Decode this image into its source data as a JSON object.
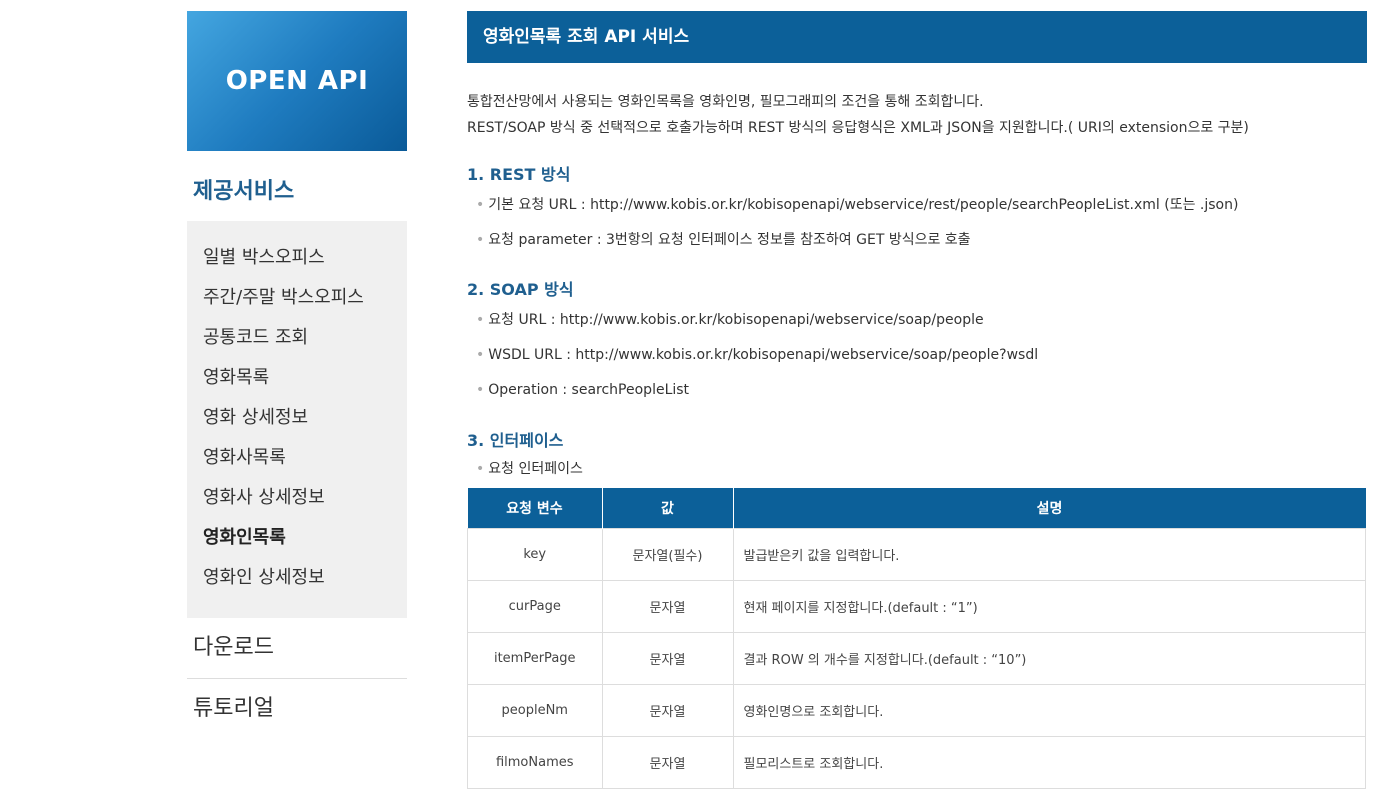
{
  "sidebar": {
    "logo_text": "OPEN API",
    "section_title": "제공서비스",
    "submenu": [
      {
        "label": "일별 박스오피스",
        "active": false
      },
      {
        "label": "주간/주말 박스오피스",
        "active": false
      },
      {
        "label": "공통코드 조회",
        "active": false
      },
      {
        "label": "영화목록",
        "active": false
      },
      {
        "label": "영화 상세정보",
        "active": false
      },
      {
        "label": "영화사목록",
        "active": false
      },
      {
        "label": "영화사 상세정보",
        "active": false
      },
      {
        "label": "영화인목록",
        "active": true
      },
      {
        "label": "영화인 상세정보",
        "active": false
      }
    ],
    "download_label": "다운로드",
    "tutorial_label": "튜토리얼"
  },
  "main": {
    "header_title": "영화인목록 조회 API 서비스",
    "intro_line1": "통합전산망에서 사용되는 영화인목록을 영화인명, 필모그래피의 조건을 통해 조회합니다.",
    "intro_line2": "REST/SOAP 방식 중 선택적으로 호출가능하며 REST 방식의 응답형식은 XML과 JSON을 지원합니다.( URI의 extension으로 구분)",
    "rest": {
      "heading": "1. REST 방식",
      "url_line": "기본 요청 URL : http://www.kobis.or.kr/kobisopenapi/webservice/rest/people/searchPeopleList.xml (또는 .json)",
      "param_line": "요청 parameter : 3번항의 요청 인터페이스 정보를 참조하여 GET 방식으로 호출"
    },
    "soap": {
      "heading": "2. SOAP 방식",
      "url_line": "요청 URL : http://www.kobis.or.kr/kobisopenapi/webservice/soap/people",
      "wsdl_line": "WSDL URL : http://www.kobis.or.kr/kobisopenapi/webservice/soap/people?wsdl",
      "operation_line": "Operation : searchPeopleList"
    },
    "interface": {
      "heading": "3. 인터페이스",
      "sub_label": "요청 인터페이스",
      "columns": [
        "요청 변수",
        "값",
        "설명"
      ],
      "rows": [
        [
          "key",
          "문자열(필수)",
          "발급받은키 값을 입력합니다."
        ],
        [
          "curPage",
          "문자열",
          "현재 페이지를 지정합니다.(default : “1”)"
        ],
        [
          "itemPerPage",
          "문자열",
          "결과 ROW 의 개수를 지정합니다.(default : “10”)"
        ],
        [
          "peopleNm",
          "문자열",
          "영화인명으로 조회합니다."
        ],
        [
          "filmoNames",
          "문자열",
          "필모리스트로 조회합니다."
        ]
      ]
    }
  }
}
